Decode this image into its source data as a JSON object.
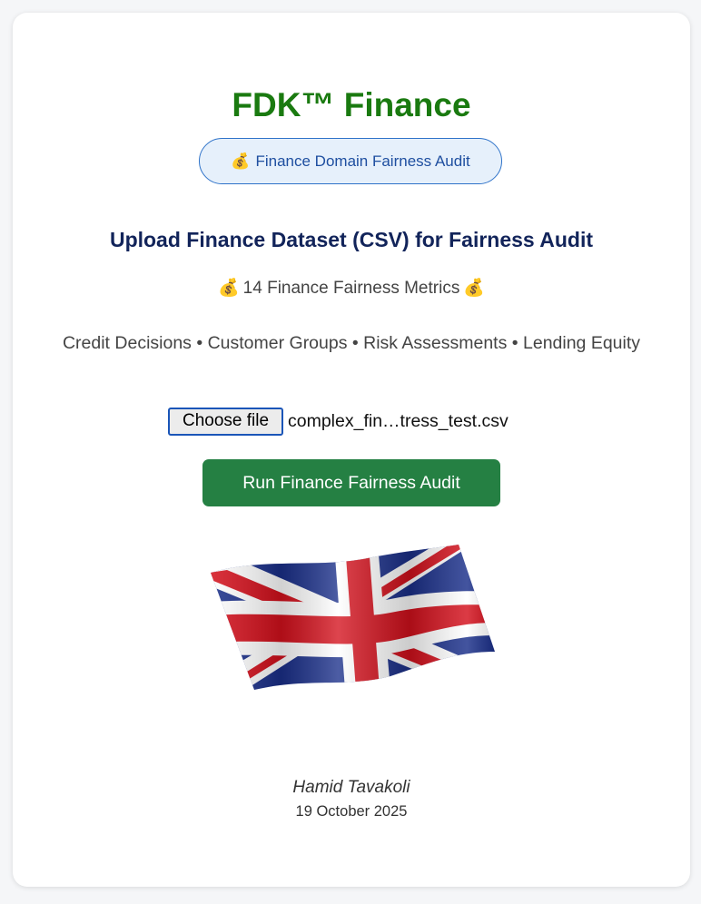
{
  "app": {
    "title": "FDK™ Finance"
  },
  "badge": {
    "icon": "money-bag-icon",
    "emoji": "💰",
    "label": "Finance Domain Fairness Audit"
  },
  "upload": {
    "heading": "Upload Finance Dataset (CSV) for Fairness Audit",
    "metrics_label": "14 Finance Fairness Metrics",
    "metrics_emoji": "💰",
    "categories": "Credit Decisions • Customer Groups • Risk Assessments • Lending Equity",
    "choose_file_label": "Choose file",
    "file_name": "complex_fin…tress_test.csv",
    "run_button_label": "Run Finance Fairness Audit"
  },
  "flag": {
    "icon": "union-jack-flag-icon"
  },
  "footer": {
    "author": "Hamid Tavakoli",
    "date": "19 October 2025"
  },
  "colors": {
    "title": "#1a7a10",
    "heading": "#12245a",
    "badge_border": "#2f73c9",
    "badge_bg": "#e6f0fb",
    "run_button": "#258043"
  }
}
